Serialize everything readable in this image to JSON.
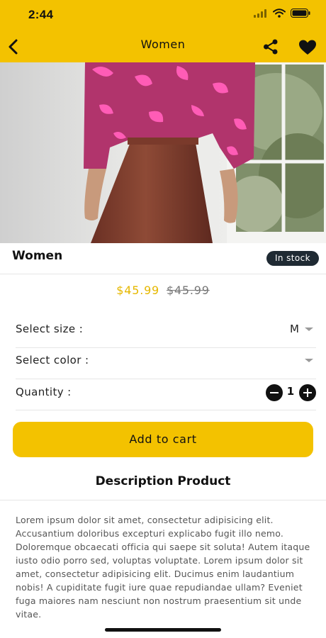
{
  "status_bar": {
    "time": "2:44"
  },
  "nav": {
    "title": "Women"
  },
  "product": {
    "name": "Women",
    "stock": "In stock",
    "price": "$45.99",
    "old_price": "$45.99"
  },
  "options": {
    "size_label": "Select size :",
    "size_value": "M",
    "color_label": "Select color :",
    "color_value": "",
    "quantity_label": "Quantity :",
    "quantity_value": "1"
  },
  "cart": {
    "button_label": "Add to cart"
  },
  "description": {
    "title": "Description Product",
    "body": "Lorem ipsum dolor sit amet, consectetur adipisicing elit. Accusantium doloribus excepturi explicabo fugit illo nemo. Doloremque obcaecati officia qui saepe sit soluta! Autem itaque iusto odio porro sed, voluptas voluptate. Lorem ipsum dolor sit amet, consectetur adipisicing elit. Ducimus enim laudantium nobis! A cupiditate fugit iure quae repudiandae ullam? Eveniet fuga maiores nam nesciunt non nostrum praesentium sit unde vitae."
  },
  "icons": {
    "back": "chevron-left-icon",
    "share": "share-icon",
    "favorite": "heart-icon",
    "signal": "signal-icon",
    "wifi": "wifi-icon",
    "battery": "battery-icon"
  },
  "colors": {
    "accent": "#f3c200",
    "badge": "#1f2a33",
    "price": "#e6b800"
  }
}
